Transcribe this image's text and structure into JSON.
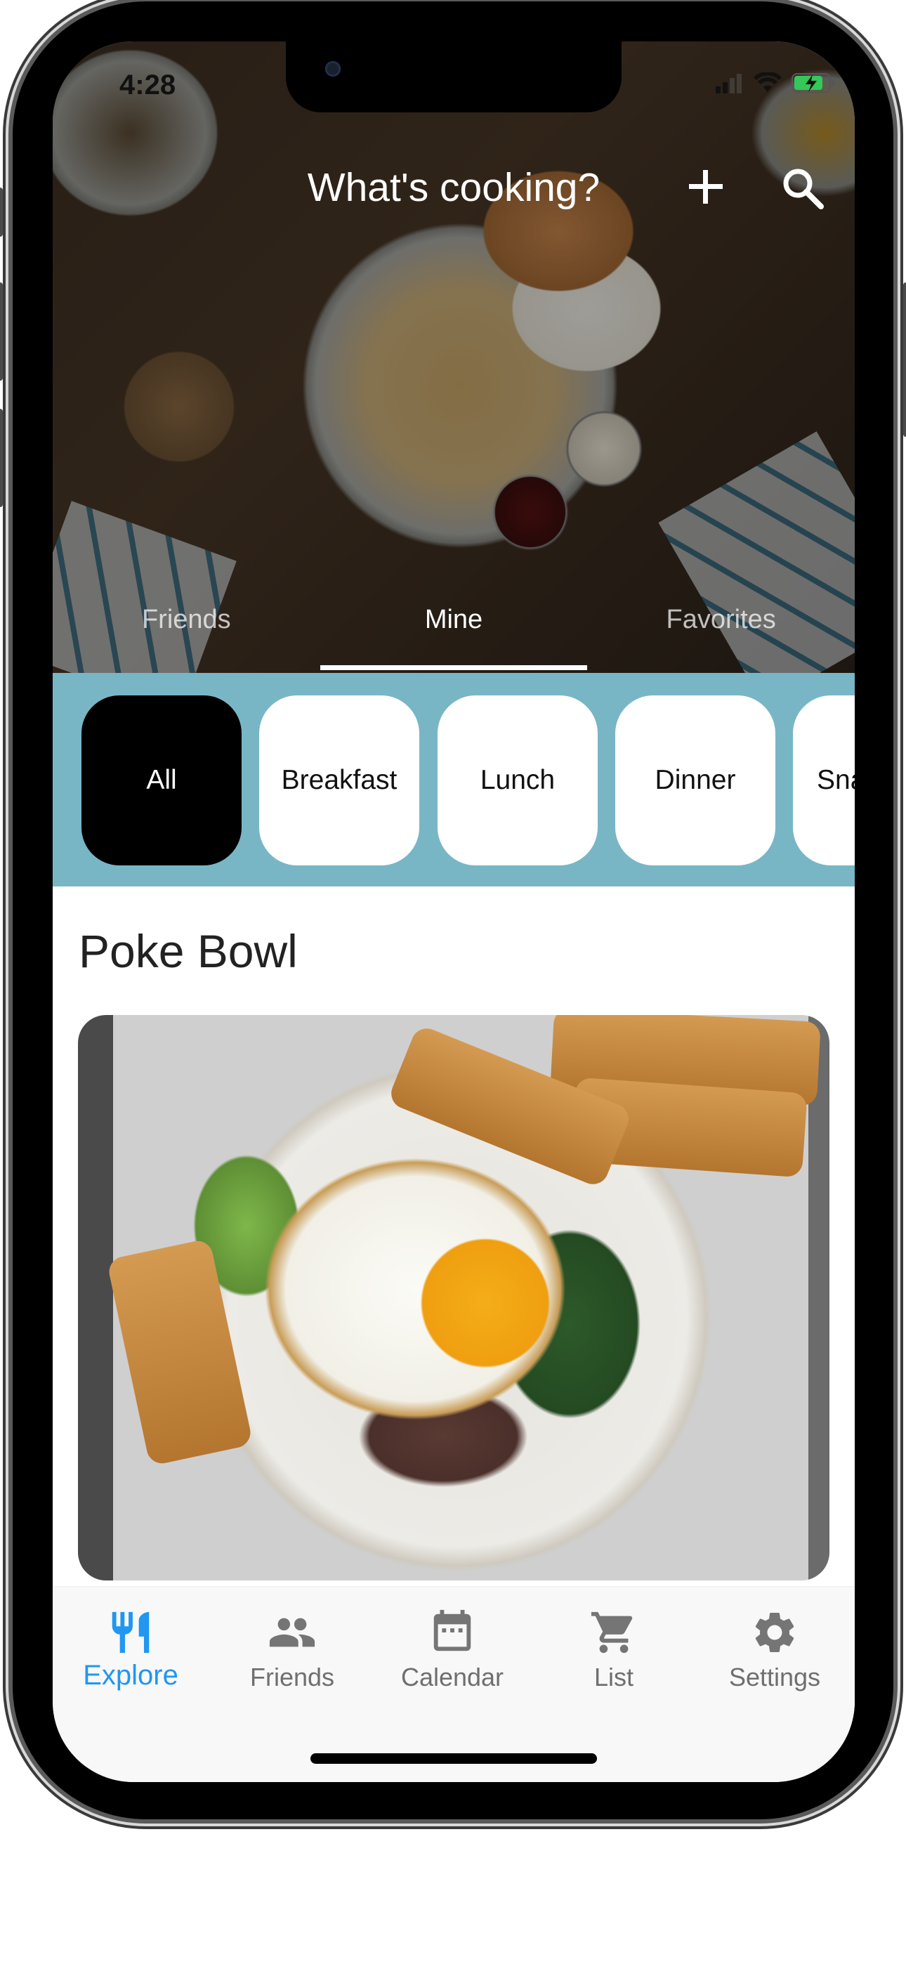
{
  "status_bar": {
    "time": "4:28",
    "icons": [
      "signal-icon",
      "wifi-icon",
      "battery-charging-icon"
    ],
    "battery_color": "#34c759"
  },
  "header": {
    "title": "What's cooking?",
    "add_icon": "plus-icon",
    "search_icon": "search-icon"
  },
  "tabs": [
    {
      "label": "Friends",
      "active": false
    },
    {
      "label": "Mine",
      "active": true
    },
    {
      "label": "Favorites",
      "active": false
    }
  ],
  "categories": {
    "background_color": "#78b6c6",
    "items": [
      {
        "label": "All",
        "active": true
      },
      {
        "label": "Breakfast",
        "active": false
      },
      {
        "label": "Lunch",
        "active": false
      },
      {
        "label": "Dinner",
        "active": false
      },
      {
        "label": "Snacks",
        "active": false
      }
    ]
  },
  "recipe": {
    "title": "Poke Bowl"
  },
  "bottom_nav": {
    "accent_color": "#2196f3",
    "items": [
      {
        "label": "Explore",
        "icon": "restaurant-icon",
        "active": true
      },
      {
        "label": "Friends",
        "icon": "people-icon",
        "active": false
      },
      {
        "label": "Calendar",
        "icon": "calendar-icon",
        "active": false
      },
      {
        "label": "List",
        "icon": "cart-icon",
        "active": false
      },
      {
        "label": "Settings",
        "icon": "gear-icon",
        "active": false
      }
    ]
  }
}
